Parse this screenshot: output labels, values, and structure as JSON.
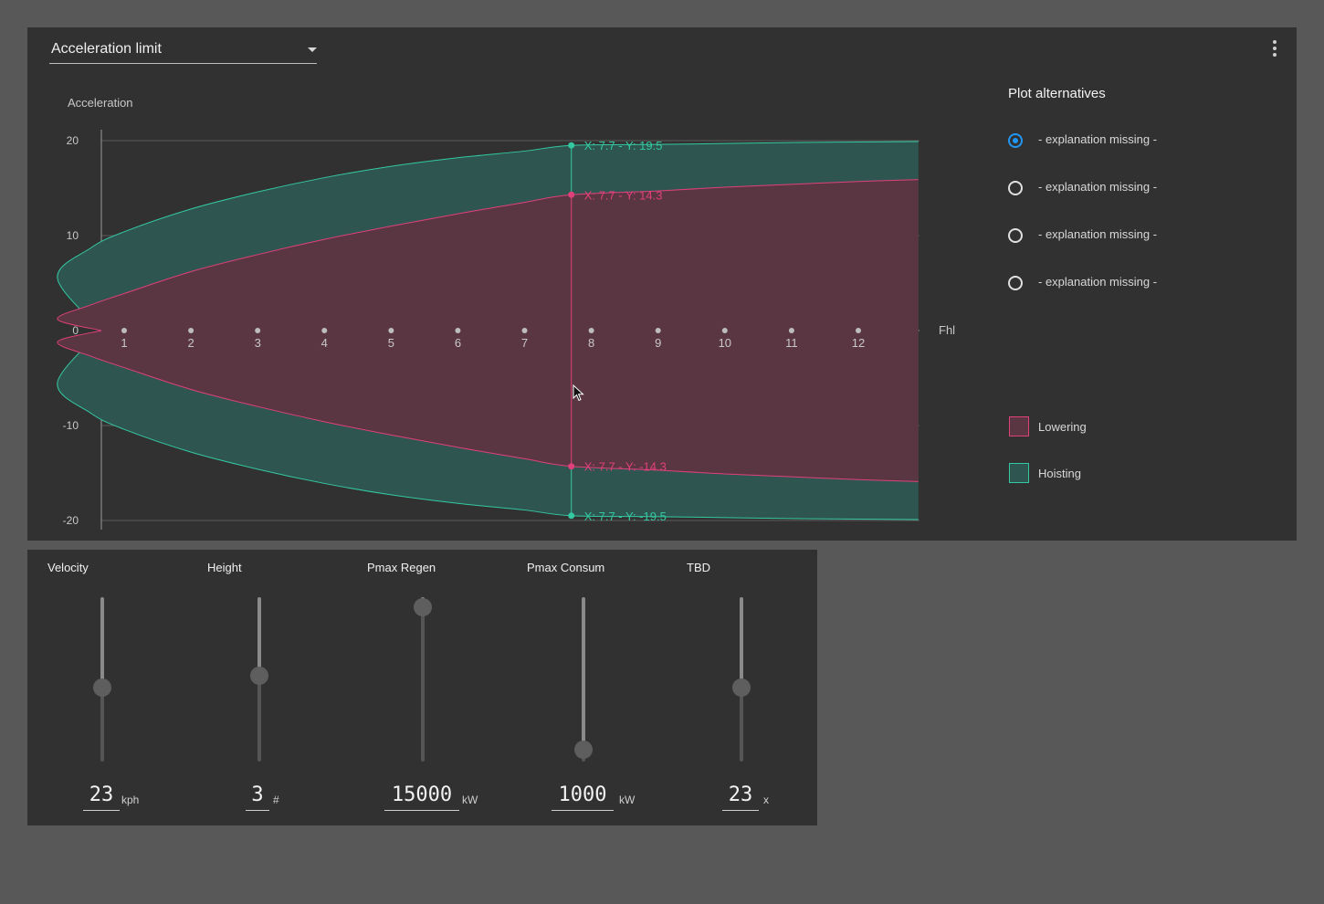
{
  "header": {
    "dropdown_label": "Acceleration limit"
  },
  "plot_alternatives": {
    "title": "Plot alternatives",
    "options": [
      {
        "label": "- explanation missing -",
        "checked": true
      },
      {
        "label": "- explanation missing -",
        "checked": false
      },
      {
        "label": "- explanation missing -",
        "checked": false
      },
      {
        "label": "- explanation missing -",
        "checked": false
      }
    ]
  },
  "legend": [
    {
      "label": "Lowering",
      "color": "#e0407a"
    },
    {
      "label": "Hoisting",
      "color": "#34c8a0"
    }
  ],
  "chart_data": {
    "type": "area",
    "title": "",
    "ylabel": "Acceleration",
    "xlabel": "Fhl",
    "xlim": [
      -0.35,
      12.9
    ],
    "ylim": [
      -20,
      20
    ],
    "x_ticks": [
      1,
      2,
      3,
      4,
      5,
      6,
      7,
      8,
      9,
      10,
      11,
      12
    ],
    "y_ticks": [
      20,
      10,
      0,
      -10,
      -20
    ],
    "y_tick_labels": [
      "20",
      "10",
      "0",
      "-10",
      "-20"
    ],
    "grid": true,
    "series": [
      {
        "name": "Hoisting",
        "color": "#34c8a0",
        "fill": "#2f5550",
        "x": [
          -0.35,
          0,
          0.5,
          1,
          2,
          3,
          4,
          5,
          6,
          7,
          7.7,
          9,
          10,
          11,
          12,
          12.9
        ],
        "upper": [
          0,
          5.5,
          8.7,
          10.4,
          12.8,
          14.6,
          16.1,
          17.3,
          18.2,
          18.9,
          19.5,
          19.6,
          19.7,
          19.8,
          19.85,
          19.9
        ],
        "lower": [
          0,
          -5.5,
          -8.7,
          -10.4,
          -12.8,
          -14.6,
          -16.1,
          -17.3,
          -18.2,
          -18.9,
          -19.5,
          -19.6,
          -19.7,
          -19.8,
          -19.85,
          -19.9
        ]
      },
      {
        "name": "Lowering",
        "color": "#e0407a",
        "fill": "#5a3643",
        "x": [
          -0.35,
          0,
          0.5,
          1,
          2,
          3,
          4,
          5,
          6,
          7,
          7.7,
          9,
          10,
          11,
          12,
          12.9
        ],
        "upper": [
          0,
          1.2,
          2.7,
          3.9,
          6.2,
          8.0,
          9.6,
          11.0,
          12.3,
          13.5,
          14.3,
          14.7,
          15.1,
          15.4,
          15.7,
          15.9
        ],
        "lower": [
          0,
          -1.2,
          -2.7,
          -3.9,
          -6.2,
          -8.0,
          -9.6,
          -11.0,
          -12.3,
          -13.5,
          -14.3,
          -14.7,
          -15.1,
          -15.4,
          -15.7,
          -15.9
        ]
      }
    ],
    "crosshair": {
      "x": 7.7,
      "points": [
        {
          "y": 19.5,
          "label": "X: 7.7 - Y: 19.5",
          "color": "#34c8a0"
        },
        {
          "y": 14.3,
          "label": "X: 7.7 - Y: 14.3",
          "color": "#e0407a"
        },
        {
          "y": -14.3,
          "label": "X: 7.7 - Y: -14.3",
          "color": "#e0407a"
        },
        {
          "y": -19.5,
          "label": "X: 7.7 - Y: -19.5",
          "color": "#34c8a0"
        }
      ]
    }
  },
  "sliders": [
    {
      "title": "Velocity",
      "value": "23",
      "unit": "kph",
      "level": 0.45
    },
    {
      "title": "Height",
      "value": "3",
      "unit": "#",
      "level": 0.52
    },
    {
      "title": "Pmax Regen",
      "value": "15000",
      "unit": "kW",
      "level": 0.94
    },
    {
      "title": "Pmax Consum",
      "value": "1000",
      "unit": "kW",
      "level": 0.07
    },
    {
      "title": "TBD",
      "value": "23",
      "unit": "x",
      "level": 0.45
    }
  ]
}
